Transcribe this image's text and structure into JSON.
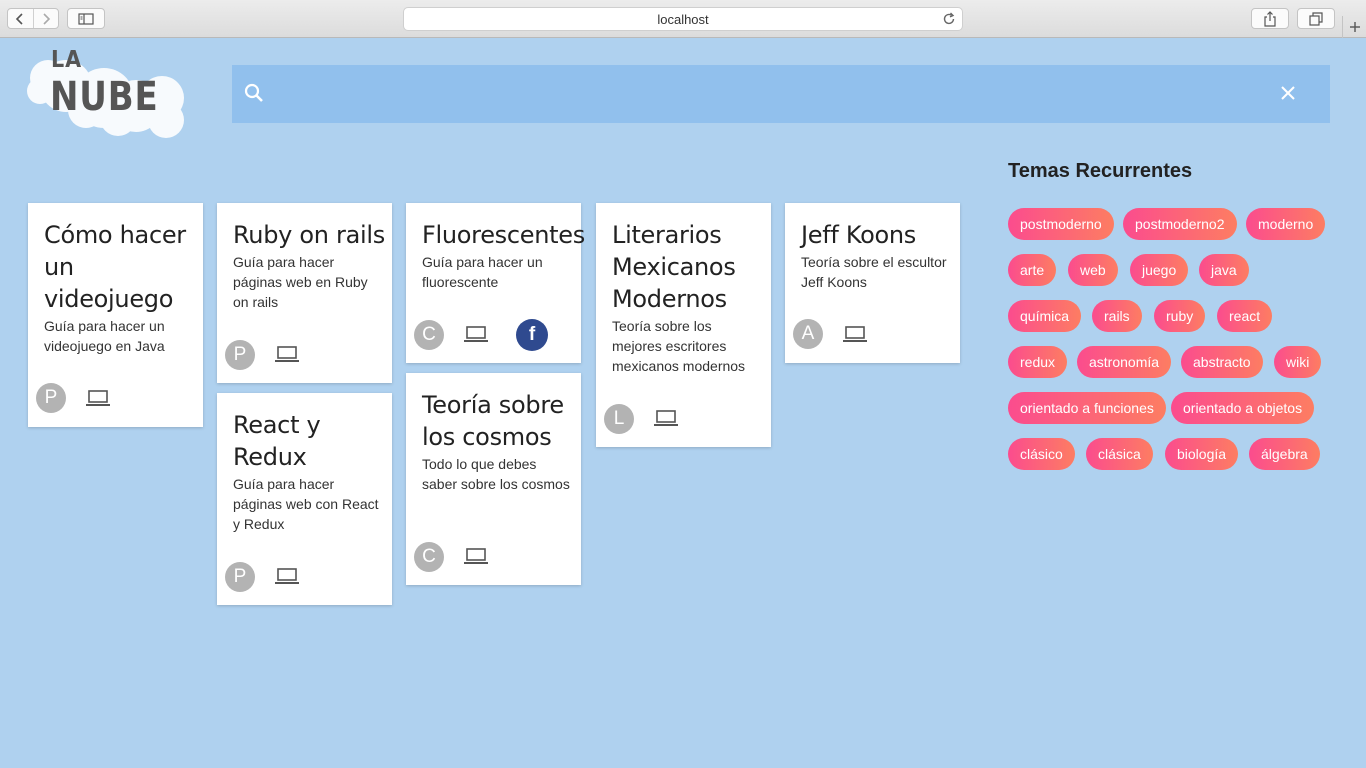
{
  "browser": {
    "url": "localhost"
  },
  "logo": {
    "line1": "LA",
    "line2": "NUBE"
  },
  "search": {
    "value": "",
    "placeholder": ""
  },
  "cards": [
    {
      "title": "Cómo hacer un videojuego",
      "description": "Guía para hacer un videojuego en Java",
      "avatar": "P"
    },
    {
      "title": "Ruby on rails",
      "description": "Guía para hacer páginas web en Ruby on rails",
      "avatar": "P"
    },
    {
      "title": "React y Redux",
      "description": "Guía para hacer páginas web con React y Redux",
      "avatar": "P"
    },
    {
      "title": "Fluorescentes",
      "description": "Guía para hacer un fluorescente",
      "avatar": "C",
      "facebook": "f"
    },
    {
      "title": "Teoría sobre los cosmos",
      "description": "Todo lo que debes saber sobre los cosmos",
      "avatar": "C"
    },
    {
      "title": "Literarios Mexicanos Modernos",
      "description": "Teoría sobre los mejores escritores mexicanos modernos",
      "avatar": "L"
    },
    {
      "title": "Jeff Koons",
      "description": "Teoría sobre el escultor Jeff Koons",
      "avatar": "A"
    }
  ],
  "topics": {
    "title": "Temas Recurrentes",
    "tags": [
      "postmoderno",
      "postmoderno2",
      "moderno",
      "arte",
      "web",
      "juego",
      "java",
      "química",
      "rails",
      "ruby",
      "react",
      "redux",
      "astronomía",
      "abstracto",
      "wiki",
      "orientado a funciones",
      "orientado a objetos",
      "clásico",
      "clásica",
      "biología",
      "álgebra"
    ]
  },
  "colors": {
    "background": "#afd1ef",
    "search_bar": "#91c0ed",
    "tag_gradient_start": "#fb4c8e",
    "tag_gradient_end": "#fd7d62",
    "facebook": "#2f4a8f",
    "avatar": "#b3b3b3"
  }
}
